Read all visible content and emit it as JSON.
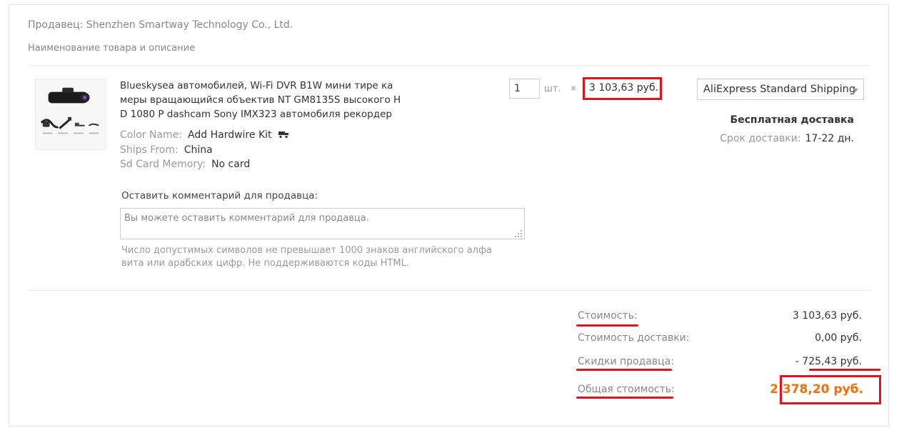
{
  "seller": {
    "label": "Продавец: Shenzhen Smartway Technology Co., Ltd."
  },
  "section": {
    "title": "Наименование товара и описание"
  },
  "product": {
    "thumb_icon": "dashcam-product-image",
    "title": "Blueskysea автомобилей, Wi-Fi DVR B1W мини тире ка меры вращающийся объектив NT GM8135S высокого H D 1080 P dashcam Sony IMX323 автомобиля рекордер",
    "attributes": [
      {
        "key": "Color Name:",
        "value": "Add Hardwire Kit",
        "icon": "car-icon"
      },
      {
        "key": "Ships From:",
        "value": "China"
      },
      {
        "key": "Sd Card Memory:",
        "value": "No card"
      }
    ],
    "quantity": "1",
    "unit": "шт.",
    "times": "×",
    "price": "3 103,63 руб."
  },
  "comment": {
    "label": "Оставить комментарий для продавца:",
    "placeholder": "Вы можете оставить комментарий для продавца.",
    "hint": "Число допустимых символов не превышает 1000 знаков английского алфа вита или арабских цифр. Не поддерживаются коды HTML."
  },
  "shipping": {
    "method": "AliExpress Standard Shipping",
    "free": "Бесплатная доставка",
    "term_label": "Срок доставки:",
    "term_value": "17-22 дн."
  },
  "summary": {
    "cost_label": "Стоимость:",
    "cost_value": "3 103,63 руб.",
    "delivery_label": "Стоимость доставки:",
    "delivery_value": "0,00 руб.",
    "discount_label": "Скидки продавца:",
    "discount_value": "- 725,43 руб.",
    "total_label": "Общая стоимость:",
    "total_value": "2 378,20 руб."
  },
  "colors": {
    "accent_orange": "#ff6a00",
    "annotation_red": "#e1141e",
    "muted": "#999999"
  }
}
